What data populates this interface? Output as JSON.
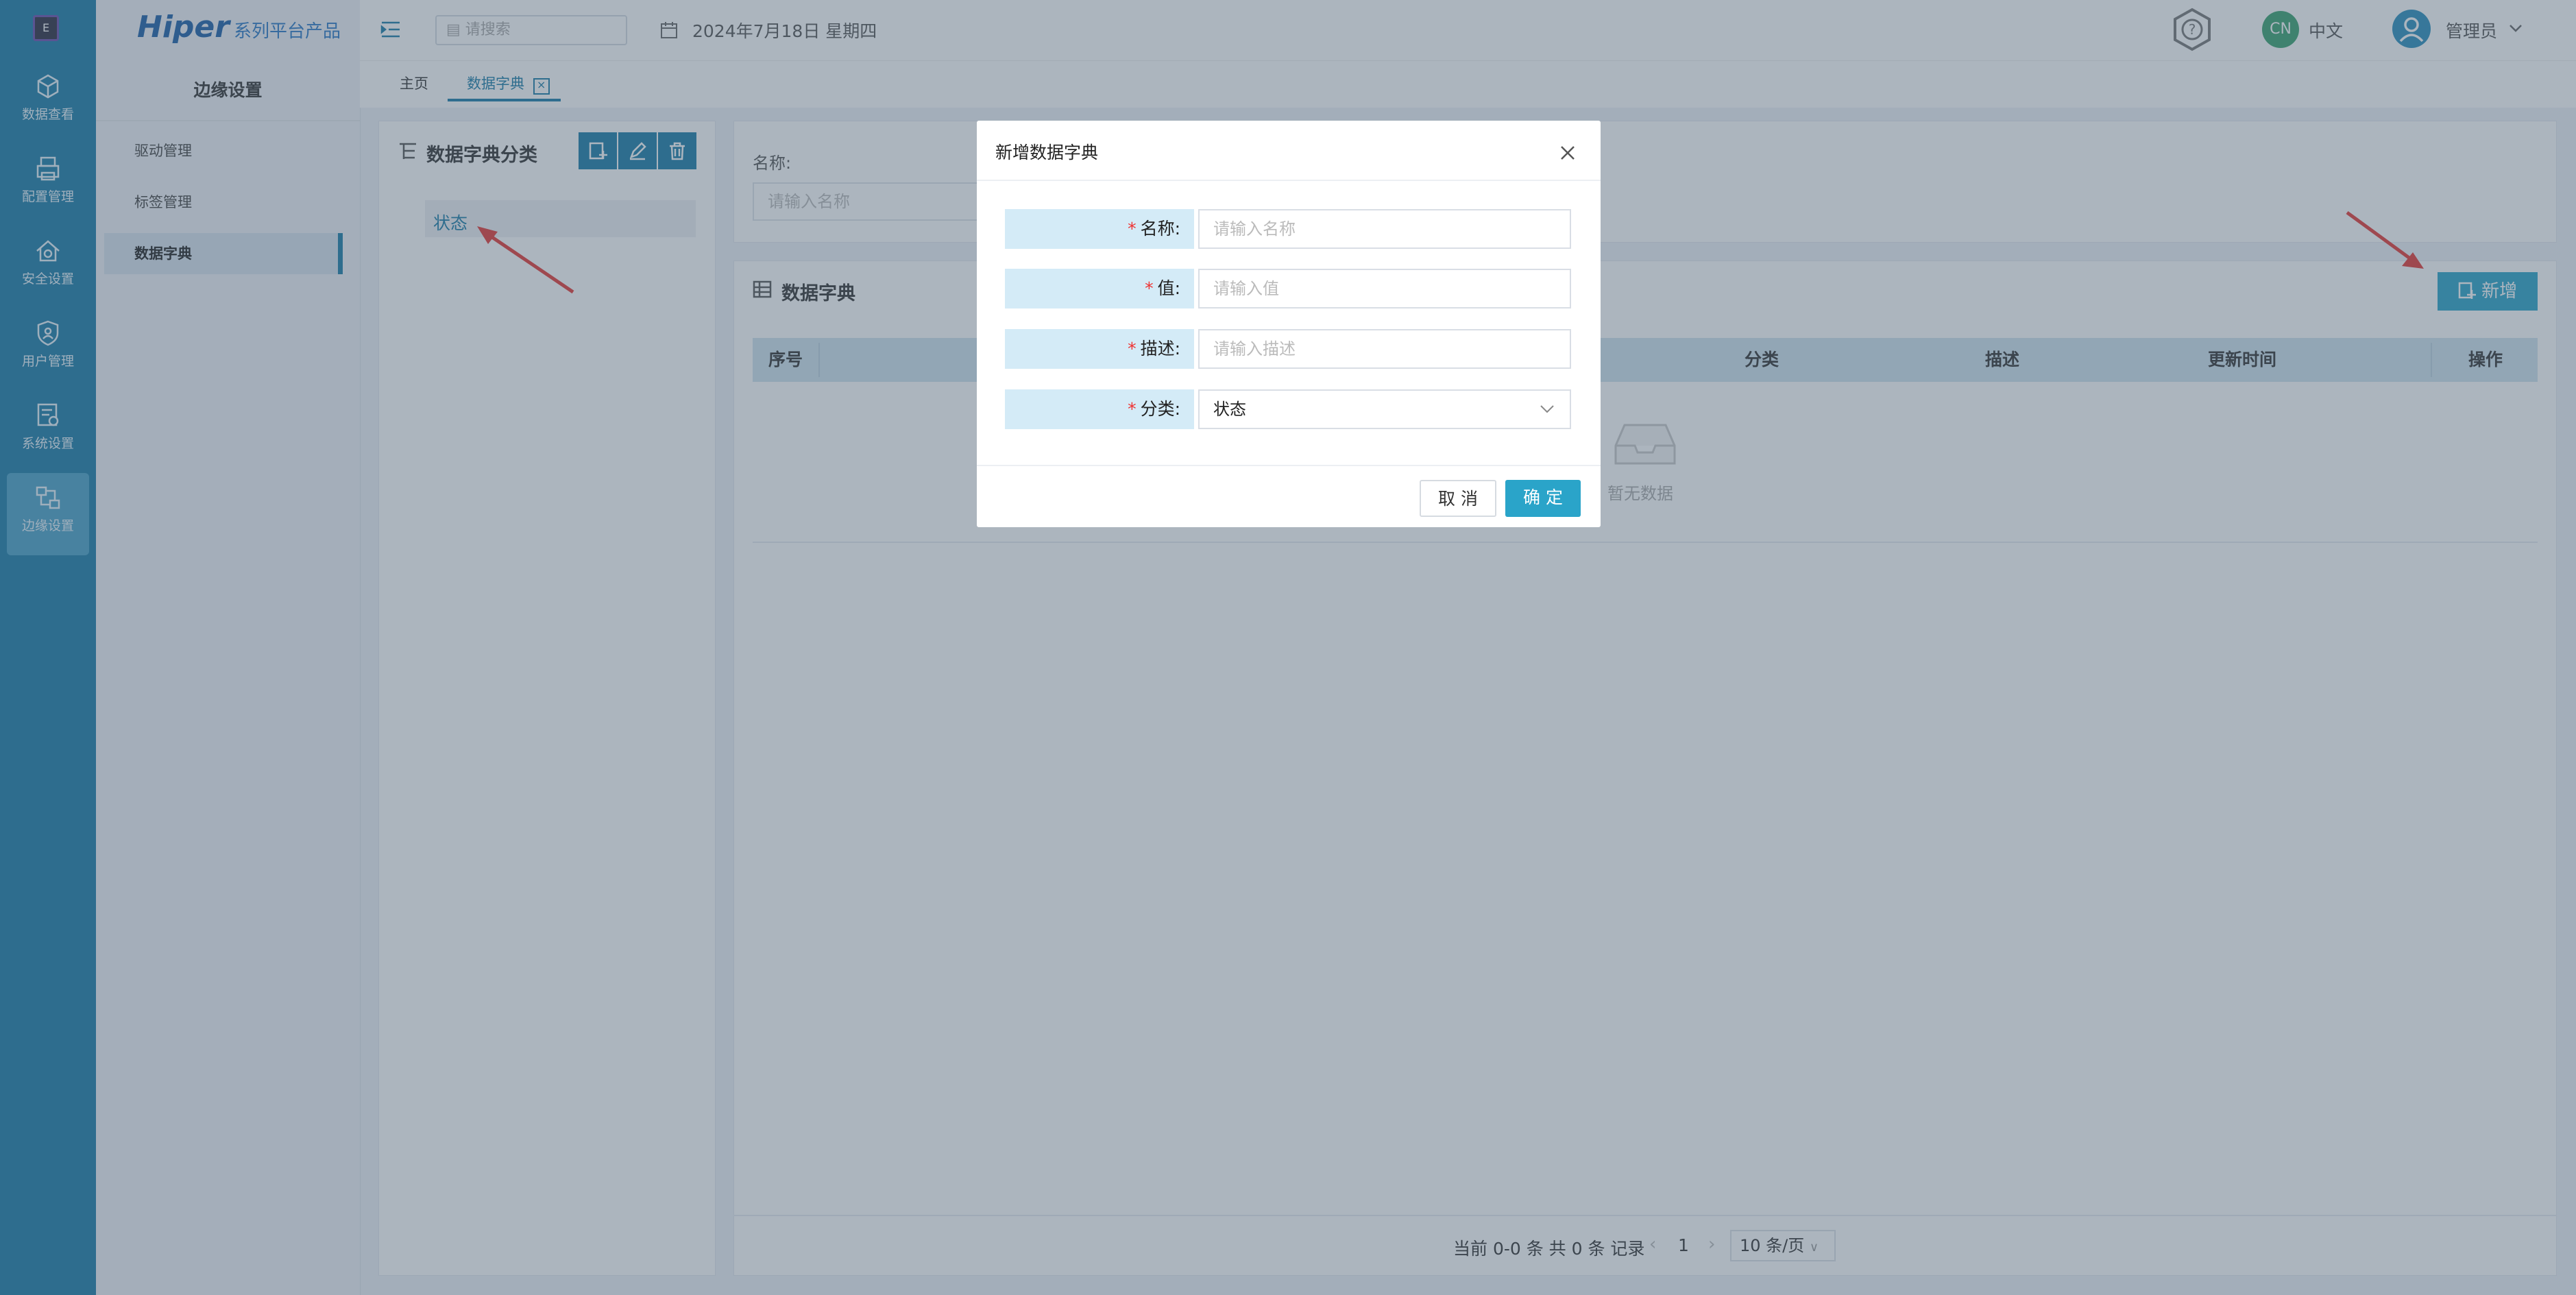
{
  "app": {
    "brand_main": "Hiper",
    "brand_sub": "系列平台产品",
    "logo_glyph": "E"
  },
  "rail": [
    {
      "label": "数据查看",
      "icon": "cube-icon"
    },
    {
      "label": "配置管理",
      "icon": "printer-icon"
    },
    {
      "label": "安全设置",
      "icon": "house-shield-icon"
    },
    {
      "label": "用户管理",
      "icon": "user-shield-icon"
    },
    {
      "label": "系统设置",
      "icon": "settings-list-icon"
    },
    {
      "label": "边缘设置",
      "icon": "edge-network-icon",
      "active": true
    }
  ],
  "sidebar": {
    "title": "边缘设置",
    "items": [
      {
        "label": "驱动管理"
      },
      {
        "label": "标签管理"
      },
      {
        "label": "数据字典",
        "active": true
      }
    ]
  },
  "header": {
    "search_placeholder": "请搜索",
    "date": "2024年7月18日 星期四",
    "lang_badge": "CN",
    "lang_label": "中文",
    "user": "管理员"
  },
  "tabs": [
    {
      "label": "主页"
    },
    {
      "label": "数据字典",
      "active": true
    }
  ],
  "category_panel": {
    "title": "数据字典分类",
    "items": [
      "状态"
    ]
  },
  "filter": {
    "name_label": "名称:",
    "name_placeholder": "请输入名称"
  },
  "dictionary": {
    "title": "数据字典",
    "add_button": "新增",
    "columns": [
      "序号",
      "分类",
      "描述",
      "更新时间",
      "操作"
    ],
    "empty_text": "暂无数据",
    "pagination": {
      "summary": "当前 0-0 条 共 0 条 记录",
      "page": "1",
      "page_size": "10 条/页"
    }
  },
  "modal": {
    "title": "新增数据字典",
    "fields": [
      {
        "label": "名称:",
        "placeholder": "请输入名称",
        "value": ""
      },
      {
        "label": "值:",
        "placeholder": "请输入值",
        "value": ""
      },
      {
        "label": "描述:",
        "placeholder": "请输入描述",
        "value": ""
      },
      {
        "label": "分类:",
        "placeholder": "",
        "value": "状态"
      }
    ],
    "cancel": "取 消",
    "confirm": "确 定"
  },
  "colors": {
    "primary": "#1a7ca8",
    "accent": "#2aa4c9",
    "arrow": "#e53935",
    "required": "#e33333"
  }
}
